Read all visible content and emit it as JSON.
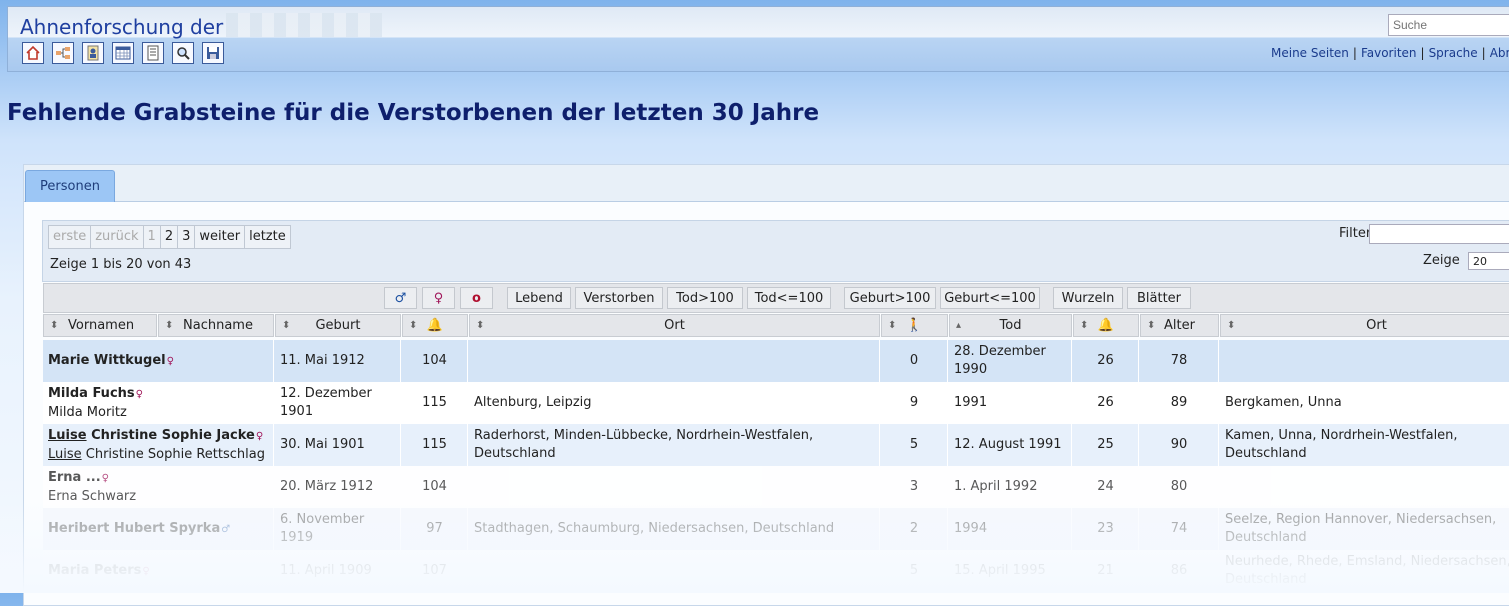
{
  "header": {
    "site_title": "Ahnenforschung der",
    "search_placeholder": "Suche",
    "toolbar_icons": [
      "home-icon",
      "pedigree-icon",
      "person-icon",
      "calendar-icon",
      "document-icon",
      "search-icon",
      "save-icon"
    ],
    "links": [
      "Meine Seiten",
      "Favoriten",
      "Sprache",
      "Abm"
    ]
  },
  "page_title": "Fehlende Grabsteine für die Verstorbenen der letzten 30 Jahre",
  "tabs": [
    "Personen"
  ],
  "pager": {
    "first": "erste",
    "prev": "zurück",
    "pages": [
      "1",
      "2",
      "3"
    ],
    "next": "weiter",
    "last": "letzte",
    "info": "Zeige 1 bis 20 von 43",
    "filter_label": "Filter",
    "show_label": "Zeige",
    "show_value": "20"
  },
  "filter_buttons": [
    "♂",
    "♀",
    "o",
    "Lebend",
    "Verstorben",
    "Tod>100",
    "Tod<=100",
    "Geburt>100",
    "Geburt<=100",
    "Wurzeln",
    "Blätter"
  ],
  "columns": [
    "Vornamen",
    "Nachname",
    "Geburt",
    "",
    "Ort",
    "",
    "Tod",
    "",
    "Alter",
    "Ort"
  ],
  "rows": [
    {
      "name": "Marie Wittkugel",
      "sex": "♀",
      "alt": "",
      "alt_u": "",
      "birth": "11. Mai 1912",
      "age_b": "104",
      "place_b": "",
      "n": "0",
      "death": "28. Dezember 1990",
      "age_d": "26",
      "age": "78",
      "place_d": ""
    },
    {
      "name": "Milda Fuchs",
      "sex": "♀",
      "alt": "Milda Moritz",
      "alt_u": "",
      "birth": "12. Dezember 1901",
      "age_b": "115",
      "place_b": "Altenburg, Leipzig",
      "n": "9",
      "death": "1991",
      "age_d": "26",
      "age": "89",
      "place_d": "Bergkamen, Unna"
    },
    {
      "name_u": "Luise",
      "name": " Christine Sophie Jacke",
      "sex": "♀",
      "alt_u": "Luise",
      "alt": " Christine Sophie Rettschlag",
      "birth": "30. Mai 1901",
      "age_b": "115",
      "place_b": "Raderhorst, Minden-Lübbecke, Nordrhein-Westfalen, Deutschland",
      "n": "5",
      "death": "12. August 1991",
      "age_d": "25",
      "age": "90",
      "place_d": "Kamen, Unna, Nordrhein-Westfalen, Deutschland"
    },
    {
      "name": "Erna ...",
      "sex": "♀",
      "alt": "Erna Schwarz",
      "alt_u": "",
      "birth": "20. März 1912",
      "age_b": "104",
      "place_b": "",
      "n": "3",
      "death": "1. April 1992",
      "age_d": "24",
      "age": "80",
      "place_d": ""
    },
    {
      "name": "Heribert Hubert Spyrka",
      "sex": "♂",
      "alt": "",
      "alt_u": "",
      "birth": "6. November 1919",
      "age_b": "97",
      "place_b": "Stadthagen, Schaumburg, Niedersachsen, Deutschland",
      "n": "2",
      "death": "1994",
      "age_d": "23",
      "age": "74",
      "place_d": "Seelze, Region Hannover, Niedersachsen, Deutschland"
    },
    {
      "name": "Maria Peters",
      "sex": "♀",
      "alt": "",
      "alt_u": "",
      "birth": "11. April 1909",
      "age_b": "107",
      "place_b": "",
      "n": "5",
      "death": "15. April 1995",
      "age_d": "21",
      "age": "86",
      "place_d": "Neurhede, Rhede, Emsland, Niedersachsen, Deutschland"
    }
  ]
}
